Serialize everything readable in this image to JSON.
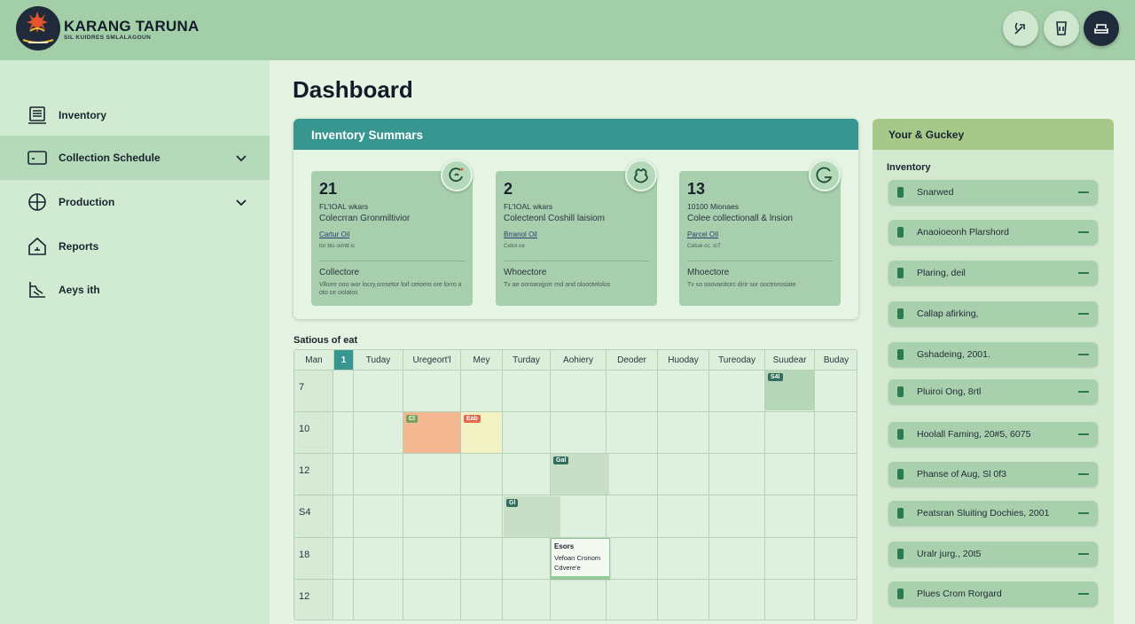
{
  "header": {
    "brand": "KARANG TARUNA",
    "brand_sub": "SIL KUIDRES SMLALAGOUN",
    "actions": [
      {
        "name": "share-action-button",
        "icon": "share-icon"
      },
      {
        "name": "drink-action-button",
        "icon": "cup-icon"
      },
      {
        "name": "profile-action-button",
        "icon": "sofa-icon"
      }
    ]
  },
  "sidebar": {
    "items": [
      {
        "label": "Inventory",
        "icon": "inventory-icon",
        "expandable": false,
        "active": false
      },
      {
        "label": "Collection Schedule",
        "icon": "card-icon",
        "expandable": true,
        "active": true
      },
      {
        "label": "Production",
        "icon": "globe-icon",
        "expandable": true,
        "active": false
      },
      {
        "label": "Reports",
        "icon": "house-icon",
        "expandable": false,
        "active": false
      },
      {
        "label": "Aeys ith",
        "icon": "profile-icon",
        "expandable": false,
        "active": false
      }
    ]
  },
  "main": {
    "title": "Dashboard",
    "summary": {
      "title": "Inventory Summars",
      "cards": [
        {
          "value": "21",
          "line1": "FL'IOAL wkars",
          "line2": "Colecrran Gronmiltivior",
          "link": "Cartur Oil",
          "line3": "tor bls oimtt ic",
          "status_title": "Collectore",
          "status_desc": "Vlkore ooo wor locry,srosetor foif cetoero ore lorro a oto ce oolatos"
        },
        {
          "value": "2",
          "line1": "FL'IOAL wkars",
          "line2": "Colecteonl Coshill laisiom",
          "link": "Brranol Oil",
          "line3": "Cetoi ce",
          "status_title": "Whoectore",
          "status_desc": "Tv ae ooroanigorr rnd and oloootelolos"
        },
        {
          "value": "13",
          "line1": "10100 Mionaes",
          "line2": "Colee collectionall & lnsion",
          "link": "Parcel OIl",
          "line3": "Cetue cc. lcT",
          "status_title": "Mhoectore",
          "status_desc": "Tv so soovanitorc dirir sor ooctrorosiate"
        }
      ]
    },
    "schedule": {
      "title": "Satious of eat",
      "days": [
        "Man",
        "1",
        "Tuday",
        "Uregeort'l",
        "Mey",
        "Turday",
        "Aohiery",
        "Deoder",
        "Huoday",
        "Tureoday",
        "Suudear",
        "Buday"
      ],
      "rows": [
        "7",
        "10",
        "12",
        "S4",
        "18",
        "12"
      ],
      "events": [
        {
          "label": "S4l",
          "color": "#b6d6b8"
        },
        {
          "label": "Cl",
          "color": "#f3b892"
        },
        {
          "label": "Eab",
          "color": "#f2f2c4"
        },
        {
          "label": "Gal",
          "color": "#c8dec6"
        },
        {
          "label": "Gl",
          "color": "#c8dec6"
        }
      ],
      "note": {
        "title": "Esors",
        "line1": "Vefoan Cronom",
        "line2": "Cdvere'e"
      }
    }
  },
  "right_panel": {
    "title": "Your & Guckey",
    "subtitle": "Inventory",
    "items": [
      "Snarwed",
      "Anaoioeonh Plarshord",
      "Plaring, deil",
      "Callap afirking,",
      "Gshadeing, 2001.",
      "Pluiroi Ong, 8rtl",
      "Hoolall Faming, 20#5, 6075",
      "Phanse of Aug, Sl 0f3",
      "Peatsran Sluiting Dochies, 2001",
      "Uralr jurg., 20t5",
      "Plues Crom Rorgard"
    ]
  },
  "colors": {
    "header_bg": "#a3cfa8",
    "sidebar_bg": "#d0ebd2",
    "accent_teal": "#37968f",
    "card_bg": "#a7cfad",
    "panel_head": "#a6c98a",
    "dark": "#1f2a3a"
  }
}
